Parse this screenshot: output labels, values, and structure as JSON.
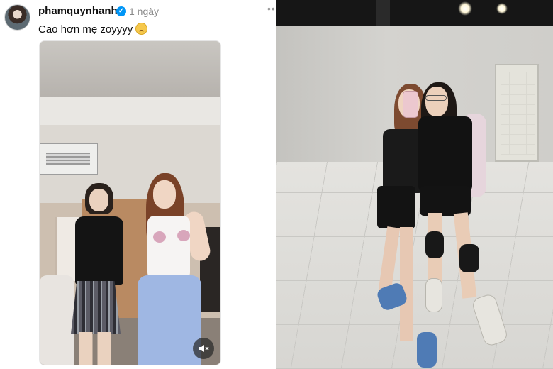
{
  "post": {
    "username": "phamquynhanh",
    "verified_mark": "✓",
    "time": "1 ngày",
    "more": "•••",
    "caption": "Cao hơn mẹ zoyyyy",
    "caption_emoji": "smiling-face-with-tear",
    "video": {
      "muted": true,
      "mute_icon": "speaker-muted-icon"
    }
  },
  "colors": {
    "verified_blue": "#0095f6",
    "text_primary": "#101010",
    "text_secondary": "#8a8a8a"
  }
}
